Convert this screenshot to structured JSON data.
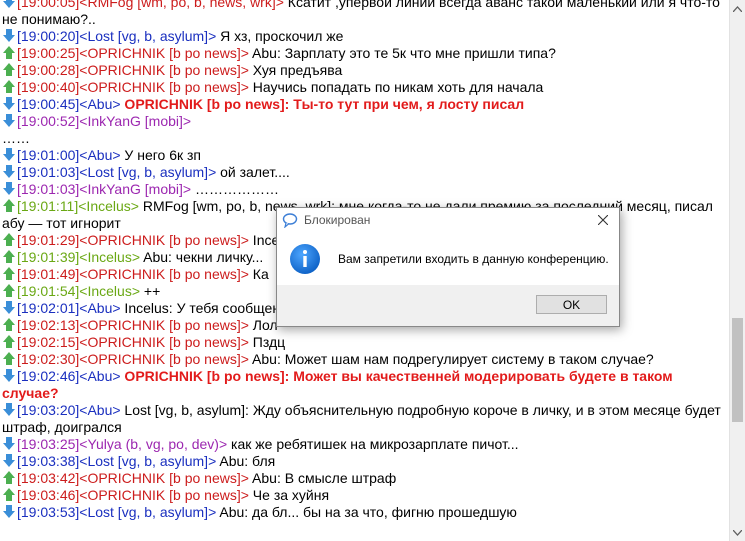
{
  "colors": {
    "operator_red": "#cc1c1c",
    "user_blue": "#1a2fbf",
    "mobile_purple": "#9c27b0",
    "member_green": "#6aa814",
    "highlight_red": "#e21b1b",
    "arrow_in": "#3a8ed8",
    "arrow_out": "#4caf50"
  },
  "chat": {
    "lines": [
      {
        "dir": "in",
        "time": "[19:00:05]",
        "nick": "<RMFog [wm, po, b, news, wrk]>",
        "color": "red",
        "text": " Ксатит ,упервой линии всегда аванс такой маленький или я что-то не понимаю?..",
        "bold": false
      },
      {
        "dir": "in",
        "time": "[19:00:20]",
        "nick": "<Lost [vg, b, asylum]>",
        "color": "blue",
        "text": " Я хз, проскочил же",
        "bold": false
      },
      {
        "dir": "out",
        "time": "[19:00:25]",
        "nick": "<OPRICHNIK [b po news]>",
        "color": "red",
        "text": " Abu: Зарплату это те 5к что мне пришли типа?",
        "bold": false
      },
      {
        "dir": "out",
        "time": "[19:00:28]",
        "nick": "<OPRICHNIK [b po news]>",
        "color": "red",
        "text": " Хуя предъява",
        "bold": false
      },
      {
        "dir": "out",
        "time": "[19:00:40]",
        "nick": "<OPRICHNIK [b po news]>",
        "color": "red",
        "text": " Научись попадать по никам хоть для начала",
        "bold": false
      },
      {
        "dir": "in",
        "time": "[19:00:45]",
        "nick": "<Abu>",
        "color": "blue",
        "text": " OPRICHNIK [b po news]: Ты-то тут при чем, я лосту писал",
        "bold": true
      },
      {
        "dir": "in",
        "time": "[19:00:52]",
        "nick": "<InkYanG [mobi]>",
        "color": "purple",
        "text": "",
        "bold": false
      },
      {
        "dir": "none",
        "time": "",
        "nick": "",
        "color": "",
        "text": "……",
        "bold": false
      },
      {
        "dir": "in",
        "time": "[19:01:00]",
        "nick": "<Abu>",
        "color": "blue",
        "text": " У него 6к зп",
        "bold": false
      },
      {
        "dir": "in",
        "time": "[19:01:03]",
        "nick": "<Lost [vg, b, asylum]>",
        "color": "blue",
        "text": " ой залет....",
        "bold": false
      },
      {
        "dir": "in",
        "time": "[19:01:03]",
        "nick": "<InkYanG [mobi]>",
        "color": "purple",
        "text": " ………………",
        "bold": false
      },
      {
        "dir": "out",
        "time": "[19:01:11]",
        "nick": "<Incelus>",
        "color": "green",
        "text": " RMFog [wm, po, b, news, wrk]: мне когда-то не дали премию за последний месяц, писал абу — тот игнорит",
        "bold": false
      },
      {
        "dir": "out",
        "time": "[19:01:29]",
        "nick": "<OPRICHNIK [b po news]>",
        "color": "red",
        "text": " Incelus: так это и есть самый лучший конец",
        "bold": false
      },
      {
        "dir": "out",
        "time": "[19:01:39]",
        "nick": "<Incelus>",
        "color": "green",
        "text": " Abu: чекни личку...",
        "bold": false
      },
      {
        "dir": "out",
        "time": "[19:01:49]",
        "nick": "<OPRICHNIK [b po news]>",
        "color": "red",
        "text": " Ка",
        "bold": false
      },
      {
        "dir": "out",
        "time": "[19:01:54]",
        "nick": "<Incelus>",
        "color": "green",
        "text": " ++",
        "bold": false
      },
      {
        "dir": "in",
        "time": "[19:02:01]",
        "nick": "<Abu>",
        "color": "blue",
        "text": " Incelus: У тебя сообщения будут приходить автоматом в отпуск отправила",
        "bold": false
      },
      {
        "dir": "out",
        "time": "[19:02:13]",
        "nick": "<OPRICHNIK [b po news]>",
        "color": "red",
        "text": " Лол",
        "bold": false
      },
      {
        "dir": "out",
        "time": "[19:02:15]",
        "nick": "<OPRICHNIK [b po news]>",
        "color": "red",
        "text": " Пздц",
        "bold": false
      },
      {
        "dir": "out",
        "time": "[19:02:30]",
        "nick": "<OPRICHNIK [b po news]>",
        "color": "red",
        "text": " Abu: Может шам нам подрегулирует систему в таком случае?",
        "bold": false
      },
      {
        "dir": "in",
        "time": "[19:02:46]",
        "nick": "<Abu>",
        "color": "blue",
        "text": " OPRICHNIK [b po news]: Может вы качественней модерировать будете в таком случае?",
        "bold": true
      },
      {
        "dir": "in",
        "time": "[19:03:20]",
        "nick": "<Abu>",
        "color": "blue",
        "text": " Lost [vg, b, asylum]: Жду объяснительную подробную короче в личку, и в этом месяце будет штраф, доигрался",
        "bold": false
      },
      {
        "dir": "in",
        "time": "[19:03:25]",
        "nick": "<Yulya (b, vg, po, dev)>",
        "color": "purple",
        "text": " как же ребятишек на микрозарплате пичот...",
        "bold": false
      },
      {
        "dir": "in",
        "time": "[19:03:38]",
        "nick": "<Lost [vg, b, asylum]>",
        "color": "blue",
        "text": " Abu: бля",
        "bold": false
      },
      {
        "dir": "out",
        "time": "[19:03:42]",
        "nick": "<OPRICHNIK [b po news]>",
        "color": "red",
        "text": " Abu: В смысле штраф",
        "bold": false
      },
      {
        "dir": "out",
        "time": "[19:03:46]",
        "nick": "<OPRICHNIK [b po news]>",
        "color": "red",
        "text": " Че за хуйня",
        "bold": false
      },
      {
        "dir": "in",
        "time": "[19:03:53]",
        "nick": "<Lost [vg, b, asylum]>",
        "color": "blue",
        "text": " Abu: да бл... бы на за что, фигню прошедшую",
        "bold": false
      }
    ]
  },
  "dialog": {
    "title": "Блокирован",
    "message": "Вам запретили входить в данную конференцию.",
    "ok_label": "OK"
  }
}
